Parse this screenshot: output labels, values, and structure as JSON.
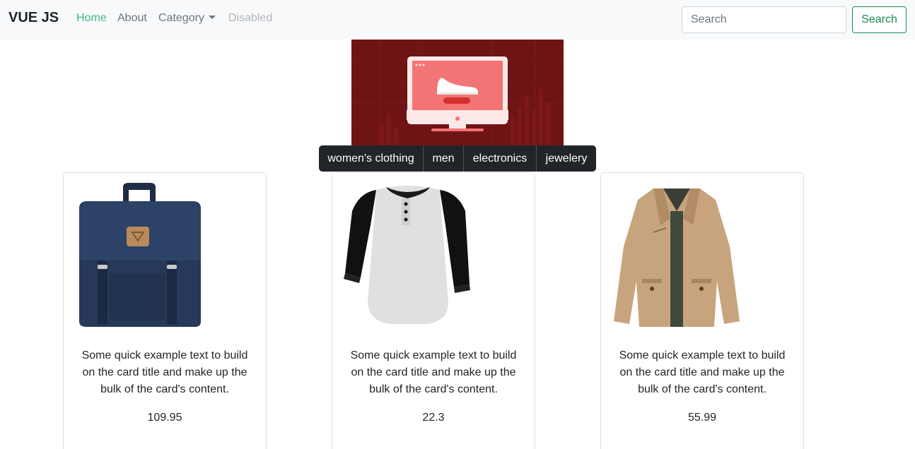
{
  "navbar": {
    "brand": "VUE JS",
    "links": [
      {
        "label": "Home",
        "active": true
      },
      {
        "label": "About"
      },
      {
        "label": "Category",
        "dropdown": true
      },
      {
        "label": "Disabled",
        "disabled": true
      }
    ],
    "search": {
      "placeholder": "Search",
      "value": "",
      "button_label": "Search"
    }
  },
  "categories": [
    "women's clothing",
    "men",
    "electronics",
    "jewelery"
  ],
  "products": [
    {
      "text": "Some quick example text to build on the card title and make up the bulk of the card's content.",
      "price": "109.95",
      "image": "backpack"
    },
    {
      "text": "Some quick example text to build on the card title and make up the bulk of the card's content.",
      "price": "22.3",
      "image": "raglan-shirt"
    },
    {
      "text": "Some quick example text to build on the card title and make up the bulk of the card's content.",
      "price": "55.99",
      "image": "jacket"
    }
  ],
  "colors": {
    "accent": "#42b983",
    "success": "#198754",
    "dark": "#212529",
    "banner": "#6e1414"
  }
}
